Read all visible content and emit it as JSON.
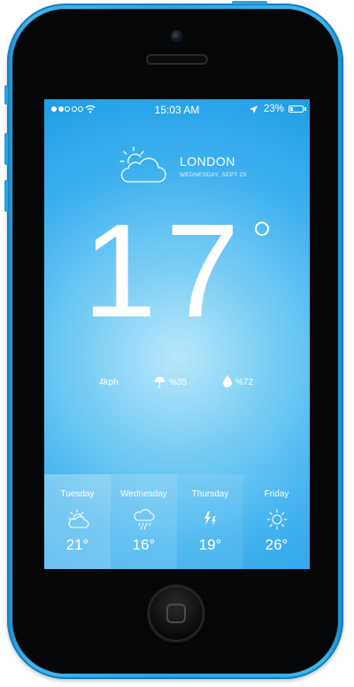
{
  "status_bar": {
    "time": "15:03 AM",
    "battery_percent": "23%",
    "battery_level": 0.23,
    "signal_dots": 5,
    "signal_filled": 2
  },
  "location": {
    "city": "LONDON",
    "date": "WEDNESDAY, SEPT 25"
  },
  "current": {
    "temperature": "17",
    "wind": "4kph",
    "precipitation": "%35",
    "humidity": "%72",
    "icon": "partly-cloudy-icon"
  },
  "forecast": [
    {
      "day": "Tuesday",
      "temp": "21°",
      "icon": "partly-sunny-icon",
      "bg": "rgba(255,255,255,0.30)"
    },
    {
      "day": "Wednesday",
      "temp": "16°",
      "icon": "rain-icon",
      "bg": "rgba(255,255,255,0.20)"
    },
    {
      "day": "Thursday",
      "temp": "19°",
      "icon": "storm-icon",
      "bg": "rgba(255,255,255,0.10)"
    },
    {
      "day": "Friday",
      "temp": "26°",
      "icon": "sun-icon",
      "bg": "rgba(255,255,255,0.03)"
    }
  ],
  "colors": {
    "phone_body": "#2aa6e2",
    "screen_top": "#1e9de6",
    "screen_glow": "#b8e7fb",
    "text": "#ffffff"
  }
}
